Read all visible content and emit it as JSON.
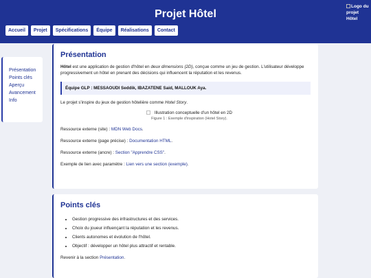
{
  "header": {
    "title": "Projet Hôtel",
    "logo_alt": "Logo du projet Hôtel",
    "bg_color": "#1f3394"
  },
  "nav": [
    "Accueil",
    "Projet",
    "Spécifications",
    "Équipe",
    "Réalisations",
    "Contact"
  ],
  "sidebar": [
    "Présentation",
    "Points clés",
    "Aperçu",
    "Avancement",
    "Info"
  ],
  "presentation": {
    "title": "Présentation",
    "intro_bold": "Hôtel",
    "intro_a": " est une application de gestion d'hôtel en ",
    "intro_italic": "deux dimensions (2D)",
    "intro_b": ", conçue comme un jeu de gestion. L'utilisateur développe progressivement un hôtel en prenant des décisions qui influencent la réputation et les revenus.",
    "team": "Équipe GLP : MESSAOUDI Seddik, IBAZATENE Said, MALLOUK Aya.",
    "inspire_a": "Le projet s'inspire du jeux de gestion hôtelière comme ",
    "inspire_italic": "Hotel Story",
    "inspire_b": ".",
    "figure_alt": "Illustration conceptuelle d'un hôtel en 2D",
    "figure_caption": "Figure 1 : Exemple d'inspiration (Hotel Story).",
    "links": [
      {
        "label": "Ressource externe (site) : ",
        "text": "MDN Web Docs",
        "after": "."
      },
      {
        "label": "Ressource externe (page précise) : ",
        "text": "Documentation HTML",
        "after": "."
      },
      {
        "label": "Ressource externe (ancre) : ",
        "text": "Section \"Apprendre CSS\"",
        "after": "."
      },
      {
        "label": "Exemple de lien avec paramètre : ",
        "text": "Lien vers une section (exemple)",
        "after": "."
      }
    ]
  },
  "points": {
    "title": "Points clés",
    "items": [
      "Gestion progressive des infrastructures et des services.",
      "Choix du joueur influençant la réputation et les revenus.",
      "Clients autonomes et évolution de l'hôtel.",
      "Objectif : développer un hôtel plus attractif et rentable."
    ],
    "back_a": "Revenir à la section ",
    "back_link": "Présentation",
    "back_b": "."
  }
}
